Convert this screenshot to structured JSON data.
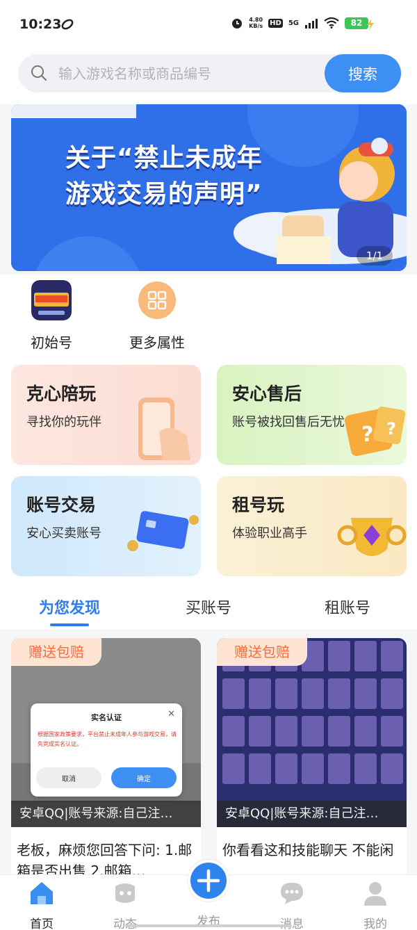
{
  "status_bar": {
    "time": "10:23",
    "net_speed_value": "4.80",
    "net_speed_unit": "KB/s",
    "hd": "HD",
    "signal": "5G",
    "battery": "82"
  },
  "search": {
    "placeholder": "输入游戏名称或商品编号",
    "button_label": "搜索"
  },
  "banner": {
    "title_line1": "关于“禁止未成年",
    "title_line2": "游戏交易的声明”",
    "page_indicator": "1/1"
  },
  "quick_links": [
    {
      "label": "初始号",
      "icon": "game-icon"
    },
    {
      "label": "更多属性",
      "icon": "grid-icon"
    }
  ],
  "feature_cards": [
    {
      "title": "克心陪玩",
      "subtitle": "寻找你的玩伴",
      "color": "#fde3dc"
    },
    {
      "title": "安心售后",
      "subtitle": "账号被找回售后无忧",
      "color": "#def5c4"
    },
    {
      "title": "账号交易",
      "subtitle": "安心买卖账号",
      "color": "#d6ecfb"
    },
    {
      "title": "租号玩",
      "subtitle": "体验职业高手",
      "color": "#fbf0d4"
    }
  ],
  "tabs": [
    {
      "label": "为您发现",
      "active": true
    },
    {
      "label": "买账号",
      "active": false
    },
    {
      "label": "租账号",
      "active": false
    }
  ],
  "listings": [
    {
      "badge": "赠送包赔",
      "caption": "安卓QQ|账号来源:自己注…",
      "description": "老板，麻烦您回答下问: 1.邮箱是否出售 2.邮箱…"
    },
    {
      "badge": "赠送包赔",
      "caption": "安卓QQ|账号来源:自己注…",
      "description": "你看看这和技能聊天 不能闲"
    }
  ],
  "modal": {
    "title": "实名认证",
    "text": "根据国家政策要求，平台禁止未成年人参与游戏交易，请先完成实名认证。",
    "cancel_label": "取消",
    "ok_label": "确定"
  },
  "bottom_nav": [
    {
      "label": "首页",
      "active": true
    },
    {
      "label": "动态",
      "active": false
    },
    {
      "label": "发布",
      "active": false
    },
    {
      "label": "消息",
      "active": false
    },
    {
      "label": "我的",
      "active": false
    }
  ],
  "colors": {
    "accent": "#2e7cf0",
    "button_blue": "#3d8ff3",
    "badge_text": "#ff6a3d"
  }
}
